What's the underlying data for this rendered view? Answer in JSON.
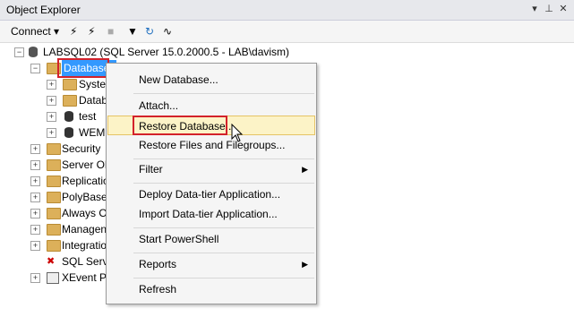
{
  "window": {
    "title": "Object Explorer"
  },
  "toolbar": {
    "connect_label": "Connect ▾"
  },
  "tree": {
    "server": "LABSQL02 (SQL Server 15.0.2000.5 - LAB\\davism)",
    "databases": "Databases",
    "children": [
      "System",
      "Datab",
      "test",
      "WEMI"
    ],
    "folders": [
      "Security",
      "Server Ob",
      "Replicatio",
      "PolyBase",
      "Always O",
      "Managen",
      "Integratio"
    ],
    "agent": "SQL Serve",
    "xevent": "XEvent Pr"
  },
  "context_menu": {
    "items": [
      "New Database...",
      "Attach...",
      "Restore Database...",
      "Restore Files and Filegroups...",
      "Filter",
      "Deploy Data-tier Application...",
      "Import Data-tier Application...",
      "Start PowerShell",
      "Reports",
      "Refresh"
    ]
  }
}
